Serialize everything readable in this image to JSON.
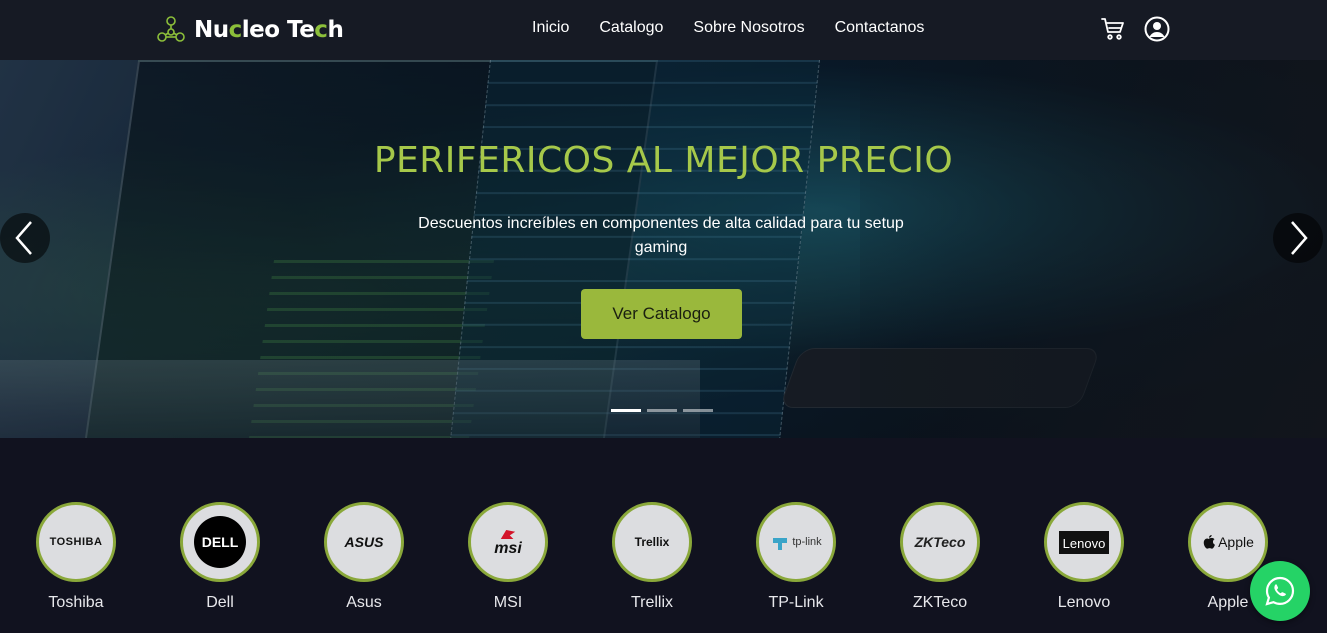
{
  "navbar": {
    "brand_part1": "Nu",
    "brand_hl1": "c",
    "brand_part2": "leo Te",
    "brand_hl2": "c",
    "brand_part3": "h",
    "links": [
      "Inicio",
      "Catalogo",
      "Sobre Nosotros",
      "Contactanos"
    ],
    "icons": [
      "cart-icon",
      "user-circle-icon"
    ]
  },
  "hero": {
    "title": "PERIFERICOS AL MEJOR PRECIO",
    "subtitle": "Descuentos increíbles en componentes de alta calidad para tu setup gaming",
    "button": "Ver Catalogo",
    "slide_count": 3,
    "active_slide": 1
  },
  "brands": [
    {
      "name": "Toshiba",
      "logo": "TOSHIBA"
    },
    {
      "name": "Dell",
      "logo": "DELL"
    },
    {
      "name": "Asus",
      "logo": "ASUS"
    },
    {
      "name": "MSI",
      "logo": "msi"
    },
    {
      "name": "Trellix",
      "logo": "Trellix"
    },
    {
      "name": "TP-Link",
      "logo": "tp-link"
    },
    {
      "name": "ZKTeco",
      "logo": "ZKTeco"
    },
    {
      "name": "Lenovo",
      "logo": "Lenovo"
    },
    {
      "name": "Apple",
      "logo": "Apple"
    }
  ],
  "colors": {
    "accent": "#a6c84a",
    "button": "#9ab83c",
    "navbar": "#161a24",
    "background": "#11121f",
    "whatsapp": "#25d366"
  }
}
